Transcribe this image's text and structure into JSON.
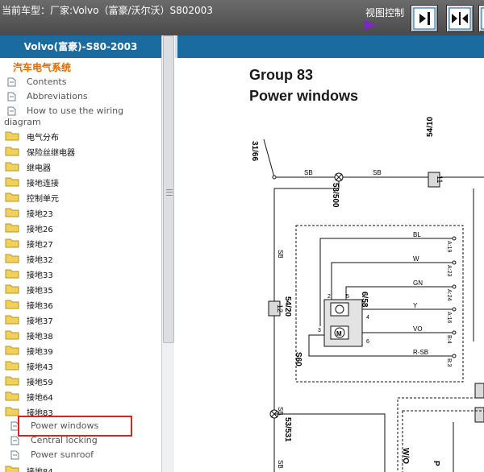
{
  "topbar": {
    "vehicle_text": "当前车型：厂家:Volvo（富豪/沃尔沃）S802003",
    "view_control_label": "视图控制",
    "buttons": [
      {
        "name": "dock-right-icon"
      },
      {
        "name": "split-view-icon"
      },
      {
        "name": "dock-left-icon"
      }
    ]
  },
  "sidebar": {
    "header": "Volvo(富豪)-S80-2003",
    "section_title": "汽车电气系统",
    "docs": [
      {
        "label": "Contents"
      },
      {
        "label": "Abbreviations"
      },
      {
        "label": "How to use the wiring"
      }
    ],
    "wrap_text": "diagram",
    "folders": [
      "电气分布",
      "保险丝继电器",
      "继电器",
      "接地连接",
      "控制单元",
      "接地23",
      "接地26",
      "接地27",
      "接地32",
      "接地33",
      "接地35",
      "接地36",
      "接地37",
      "接地38",
      "接地39",
      "接地43",
      "接地59",
      "接地64",
      "接地83"
    ],
    "subitems": [
      {
        "label": "Power windows",
        "selected": true
      },
      {
        "label": "Central locking"
      },
      {
        "label": "Power sunroof"
      }
    ],
    "partial_row": "接地84"
  },
  "diagram": {
    "title_line1": "Group 83",
    "title_line2": "Power windows",
    "labels": {
      "c3166": "31/66",
      "c5410": "54/10",
      "sb": "SB",
      "c11": "11",
      "c53500": "53/500",
      "bl": "BL",
      "a19": "A:19",
      "w": "W",
      "a23": "A:23",
      "gn": "GN",
      "a24": "A:24",
      "y": "Y",
      "a16": "A:16",
      "vo": "VO",
      "b4": "B:4",
      "rsb": "R-SB",
      "b3": "B:3",
      "c5420": "54/20",
      "c12": "12",
      "c658": "6/58",
      "s60": "S60",
      "p2": "2",
      "p5": "5",
      "p4": "4",
      "p3": "3",
      "p6": "6",
      "c53531": "53/531",
      "wo": "W/O",
      "p": "P"
    }
  }
}
